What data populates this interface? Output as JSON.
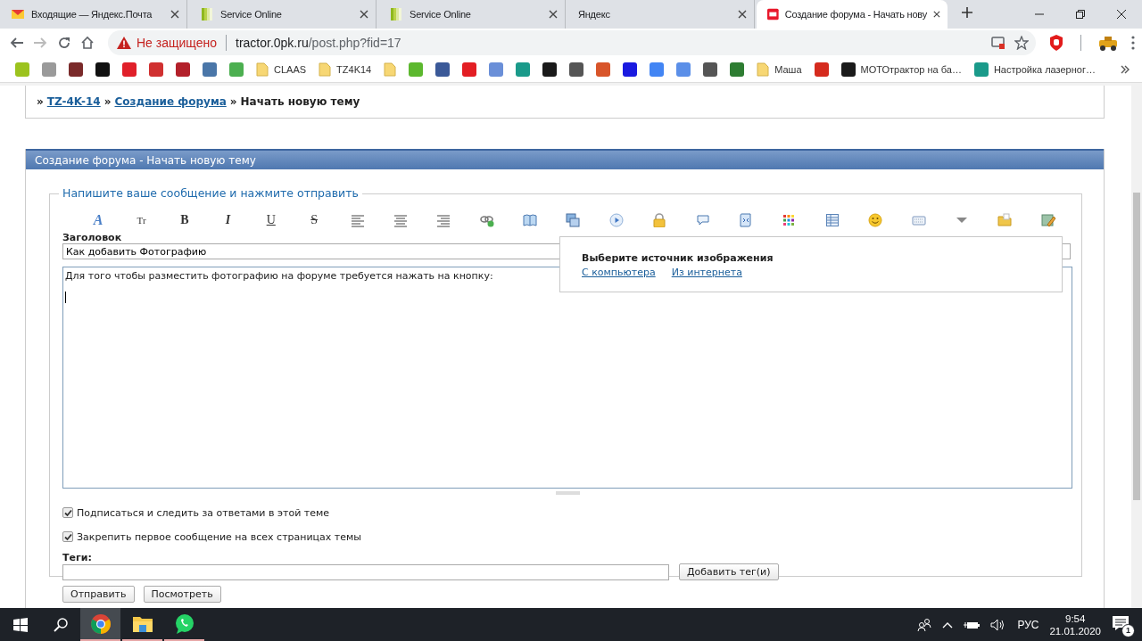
{
  "browser": {
    "tabs": [
      {
        "label": "Входящие — Яндекс.Почта",
        "selected": false,
        "kind": "mail"
      },
      {
        "label": "Service Online",
        "selected": false,
        "kind": "service"
      },
      {
        "label": "Service Online",
        "selected": false,
        "kind": "service"
      },
      {
        "label": "Яндекс",
        "selected": false,
        "kind": "plain"
      },
      {
        "label": "Создание форума - Начать нову",
        "selected": true,
        "kind": "tz"
      }
    ],
    "security_label": "Не защищено",
    "url_host": "tractor.0pk.ru",
    "url_path": "/post.php?fid=17",
    "bookmarks": [
      {
        "kind": "site",
        "color": "#9cc31e"
      },
      {
        "kind": "site",
        "color": "#9a9a9a"
      },
      {
        "kind": "site",
        "color": "#7a2a2a"
      },
      {
        "kind": "site",
        "color": "#111111"
      },
      {
        "kind": "site",
        "color": "#e0202a"
      },
      {
        "kind": "site",
        "color": "#d03030"
      },
      {
        "kind": "site",
        "color": "#b3202a"
      },
      {
        "kind": "site",
        "color": "#4a76a8"
      },
      {
        "kind": "site",
        "color": "#4caf50"
      },
      {
        "kind": "folder",
        "label": "CLAAS"
      },
      {
        "kind": "folder",
        "label": "TZ4K14"
      },
      {
        "kind": "folder"
      },
      {
        "kind": "site",
        "color": "#5cb82e"
      },
      {
        "kind": "site",
        "color": "#3b5998"
      },
      {
        "kind": "site",
        "color": "#e31e24"
      },
      {
        "kind": "site",
        "color": "#6a8fd8"
      },
      {
        "kind": "site",
        "color": "#1a9a8a"
      },
      {
        "kind": "site",
        "color": "#1a1a1a"
      },
      {
        "kind": "site",
        "color": "#555555"
      },
      {
        "kind": "site",
        "color": "#d8552a"
      },
      {
        "kind": "site",
        "color": "#1a1ae0"
      },
      {
        "kind": "site",
        "color": "#4285f4"
      },
      {
        "kind": "site",
        "color": "#5b8fe8"
      },
      {
        "kind": "site",
        "color": "#555555"
      },
      {
        "kind": "site",
        "color": "#2e7d32"
      },
      {
        "kind": "folder",
        "label": "Маша"
      },
      {
        "kind": "site",
        "color": "#d52b1e"
      },
      {
        "kind": "site",
        "color": "#1a1a1a",
        "label": "МОТОтрактор на ба…"
      },
      {
        "kind": "site",
        "color": "#1a9a8a",
        "label": "Настройка лазерног…"
      }
    ]
  },
  "breadcrumb": [
    {
      "label": "»",
      "kind": "sep"
    },
    {
      "label": "TZ-4K-14",
      "kind": "link"
    },
    {
      "label": "»",
      "kind": "sep"
    },
    {
      "label": "Создание форума",
      "kind": "link"
    },
    {
      "label": "»",
      "kind": "sep"
    },
    {
      "label": "Начать новую тему",
      "kind": "current"
    }
  ],
  "panel": {
    "title": "Создание форума - Начать новую тему",
    "legend": "Напишите ваше сообщение и нажмите отправить",
    "toolbar": [
      {
        "kind": "font-color",
        "label": "A"
      },
      {
        "kind": "font-size",
        "label": "Tr"
      },
      {
        "kind": "bold",
        "label": "B"
      },
      {
        "kind": "italic",
        "label": "I"
      },
      {
        "kind": "underline",
        "label": "U"
      },
      {
        "kind": "strike",
        "label": "S"
      },
      {
        "kind": "align-left"
      },
      {
        "kind": "align-center"
      },
      {
        "kind": "align-right"
      },
      {
        "kind": "link"
      },
      {
        "kind": "book"
      },
      {
        "kind": "image"
      },
      {
        "kind": "play"
      },
      {
        "kind": "lock"
      },
      {
        "kind": "bubble"
      },
      {
        "kind": "script"
      },
      {
        "kind": "palette"
      },
      {
        "kind": "table"
      },
      {
        "kind": "smiley"
      },
      {
        "kind": "keyboard"
      },
      {
        "kind": "more"
      },
      {
        "kind": "folder"
      },
      {
        "kind": "edit-image"
      }
    ],
    "subject_label": "Заголовок",
    "subject_value": "Как добавить Фотографию",
    "message": "Для того чтобы разместить фотографию на форуме требуется нажать на кнопку:",
    "options": [
      {
        "label": "Подписаться и следить за ответами в этой теме",
        "checked": true
      },
      {
        "label": "Закрепить первое сообщение на всех страницах темы",
        "checked": true
      }
    ],
    "tags_label": "Теги:",
    "add_tag_button": "Добавить тег(и)",
    "buttons": [
      "Отправить",
      "Посмотреть"
    ]
  },
  "image_popup": {
    "title": "Выберите источник изображения",
    "links": [
      "С компьютера",
      "Из интернета"
    ]
  },
  "taskbar": {
    "apps": [
      {
        "kind": "chrome",
        "selected": true
      },
      {
        "kind": "explorer",
        "selected": false
      },
      {
        "kind": "whatsapp",
        "selected": false
      }
    ],
    "language": "РУС",
    "time": "9:54",
    "date": "21.01.2020",
    "notifications": "1"
  }
}
